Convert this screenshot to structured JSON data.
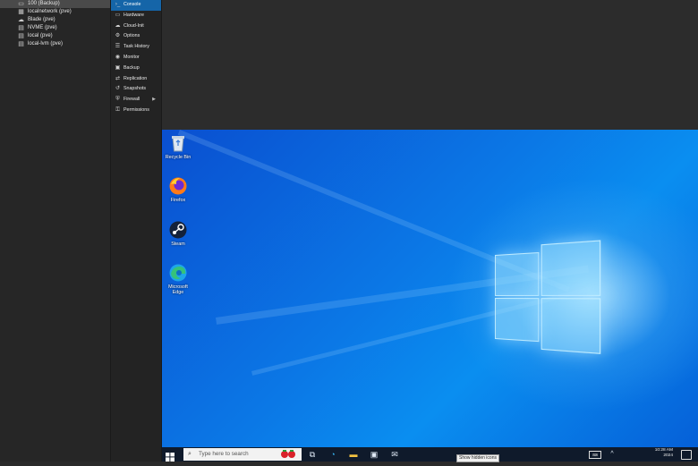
{
  "tree": {
    "items": [
      {
        "label": "100 (Backup)",
        "icon": "monitor-icon",
        "selected": true
      },
      {
        "label": "localnetwork (pve)",
        "icon": "grid-icon",
        "selected": false
      },
      {
        "label": "Blade (pve)",
        "icon": "cloud-icon",
        "selected": false
      },
      {
        "label": "NVME (pve)",
        "icon": "storage-icon",
        "selected": false
      },
      {
        "label": "local (pve)",
        "icon": "storage-icon",
        "selected": false
      },
      {
        "label": "local-lvm (pve)",
        "icon": "storage-icon",
        "selected": false
      }
    ]
  },
  "menu": {
    "items": [
      {
        "label": "Console",
        "icon": ">_",
        "active": true
      },
      {
        "label": "Hardware",
        "icon": "monitor-icon"
      },
      {
        "label": "Cloud-Init",
        "icon": "cloud-icon"
      },
      {
        "label": "Options",
        "icon": "gear-icon"
      },
      {
        "label": "Task History",
        "icon": "list-icon"
      },
      {
        "label": "Monitor",
        "icon": "eye-icon"
      },
      {
        "label": "Backup",
        "icon": "floppy-icon"
      },
      {
        "label": "Replication",
        "icon": "retweet-icon"
      },
      {
        "label": "Snapshots",
        "icon": "history-icon"
      },
      {
        "label": "Firewall",
        "icon": "shield-icon",
        "has_submenu": true
      },
      {
        "label": "Permissions",
        "icon": "unlock-icon"
      }
    ]
  },
  "desktop": {
    "icons": [
      {
        "label": "Recycle Bin",
        "icon": "recycle-bin-icon"
      },
      {
        "label": "Firefox",
        "icon": "firefox-icon"
      },
      {
        "label": "Steam",
        "icon": "steam-icon"
      },
      {
        "label": "Microsoft Edge",
        "icon": "edge-icon"
      }
    ]
  },
  "taskbar": {
    "search_placeholder": "Type here to search",
    "clock_time": "10:28 AM",
    "clock_date": "2024",
    "tooltip": "Show hidden icons"
  },
  "colors": {
    "accent": "#1565a8",
    "desktop_blue": "#0b78e6",
    "taskbar": "#0f1a2b"
  }
}
